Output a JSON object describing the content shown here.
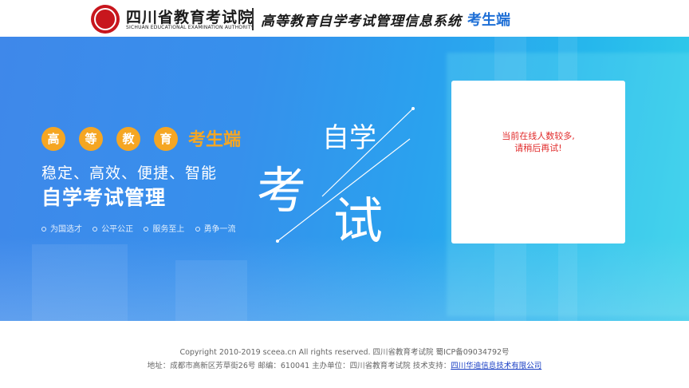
{
  "header": {
    "org_name": "四川省教育考试院",
    "org_name_en": "SICHUAN EDUCATIONAL EXAMINATION AUTHORITY",
    "system_name": "高等教育自学考试管理信息系统",
    "client_name": "考生端"
  },
  "banner": {
    "circle_chars": [
      "高",
      "等",
      "教",
      "育"
    ],
    "kaosheng": "考生端",
    "slogan": "稳定、高效、便捷、智能",
    "title": "自学考试管理",
    "tags": [
      "为国选才",
      "公平公正",
      "服务至上",
      "勇争一流"
    ],
    "art": {
      "top": "自学",
      "left": "考",
      "right": "试"
    }
  },
  "panel": {
    "message_line1": "当前在线人数较多,",
    "message_line2": "请稍后再试!"
  },
  "footer": {
    "copyright": "Copyright 2010-2019 sceea.cn All rights reserved. 四川省教育考试院 蜀ICP备09034792号",
    "address": "地址：成都市高新区芳草街26号 邮编：610041 主办单位：四川省教育考试院 技术支持：",
    "support_link": "四川华迪信息技术有限公司"
  },
  "colors": {
    "accent_blue": "#1e6fd6",
    "orange": "#f5a623",
    "error_red": "#e12b2b",
    "seal_red": "#c8161d"
  }
}
